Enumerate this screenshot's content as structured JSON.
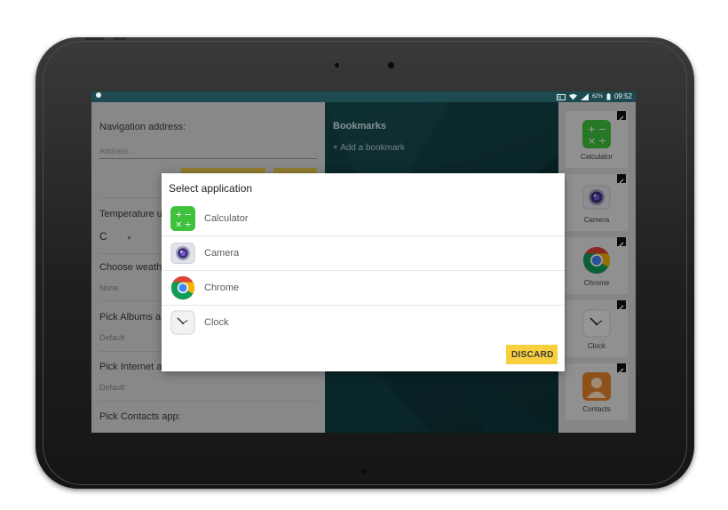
{
  "status_bar": {
    "time": "09:52",
    "battery": "62%",
    "icons": [
      "nfc-icon",
      "wifi-icon",
      "signal-icon",
      "battery-icon"
    ]
  },
  "left_panel": {
    "navigation_label": "Navigation address:",
    "address_placeholder": "Address",
    "temperature_label": "Temperature u",
    "temperature_value": "C",
    "weather_label": "Choose weath",
    "weather_value": "None",
    "albums_label": "Pick Albums a",
    "albums_value": "Default",
    "internet_label": "Pick Internet a",
    "internet_value": "Default",
    "contacts_label": "Pick Contacts app:"
  },
  "bookmarks_panel": {
    "title": "Bookmarks",
    "add_label": "+ Add a bookmark"
  },
  "app_column": {
    "tiles": [
      {
        "label": "Calculator",
        "icon": "calculator-icon"
      },
      {
        "label": "Camera",
        "icon": "camera-icon"
      },
      {
        "label": "Chrome",
        "icon": "chrome-icon"
      },
      {
        "label": "Clock",
        "icon": "clock-icon"
      },
      {
        "label": "Contacts",
        "icon": "contacts-icon"
      }
    ]
  },
  "dialog": {
    "title": "Select application",
    "items": [
      {
        "label": "Calculator",
        "icon": "calculator-icon"
      },
      {
        "label": "Camera",
        "icon": "camera-icon"
      },
      {
        "label": "Chrome",
        "icon": "chrome-icon"
      },
      {
        "label": "Clock",
        "icon": "clock-icon"
      }
    ],
    "discard_label": "DISCARD"
  },
  "colors": {
    "accent_yellow": "#f7cf3f",
    "status_bar": "#1c4a50",
    "bookmarks_bg": "#0f3b40",
    "calculator_green": "#3ec23e"
  }
}
